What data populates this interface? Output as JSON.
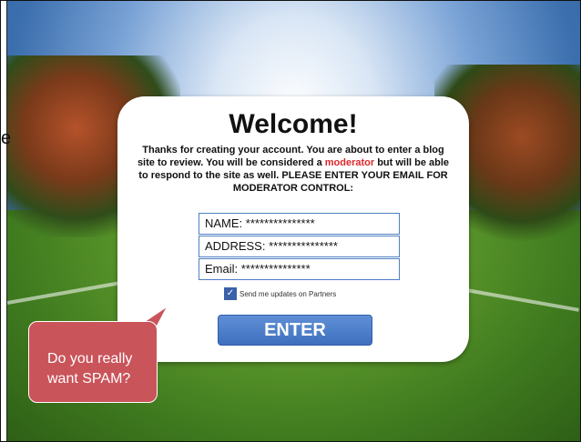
{
  "card": {
    "title": "Welcome!",
    "intro_part1": "Thanks for creating your account. You are about to enter a blog site to review. You will be considered a ",
    "intro_highlight": "moderator",
    "intro_part2": " but will be able to respond to the site as well.  PLEASE ENTER YOUR EMAIL FOR MODERATOR CONTROL:",
    "fields": [
      {
        "label": "NAME:",
        "value": "***************"
      },
      {
        "label": "ADDRESS:",
        "value": "***************"
      },
      {
        "label": "Email:",
        "value": "***************"
      }
    ],
    "checkbox_label": "Send me updates on Partners",
    "checkbox_checked": true,
    "enter_label": "ENTER"
  },
  "callout": {
    "text": "Do you really want SPAM?"
  },
  "edge_char": "e",
  "colors": {
    "accent": "#3f70be",
    "callout": "#c9545a",
    "highlight": "#e0262b"
  }
}
